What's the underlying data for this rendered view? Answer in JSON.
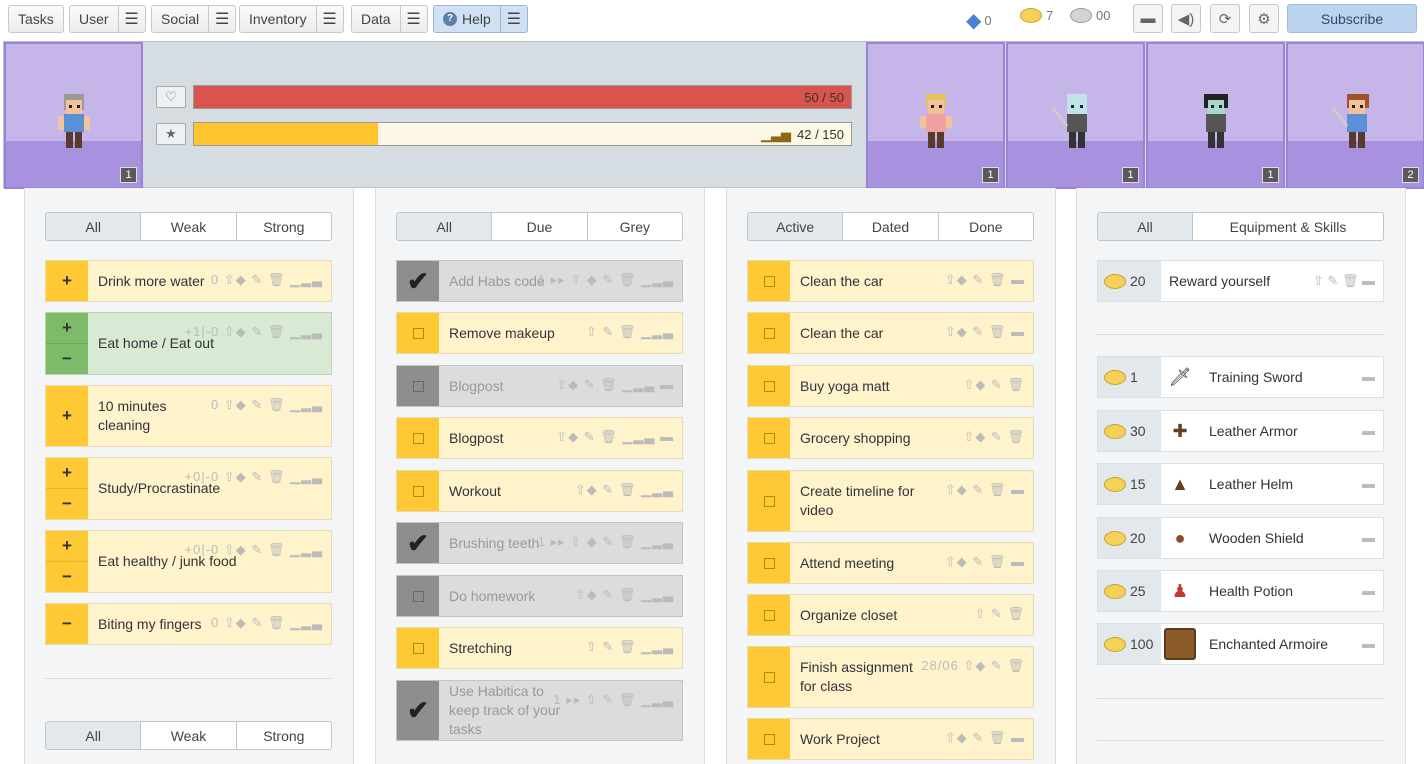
{
  "nav": {
    "menus": [
      "Tasks",
      "User",
      "Social",
      "Inventory",
      "Data",
      "Help"
    ],
    "gems": "0",
    "gold": "7",
    "silver": "00",
    "subscribe": "Subscribe"
  },
  "header": {
    "player_level": "1",
    "hp_text": "50 / 50",
    "hp_fraction": 1.0,
    "xp_text": "42 / 150",
    "xp_fraction": 0.28,
    "party_levels": [
      "1",
      "1",
      "1",
      "2"
    ]
  },
  "habits": {
    "filters": [
      "All",
      "Weak",
      "Strong"
    ],
    "items": [
      {
        "text": "Drink more water",
        "meta": "0 ⇧◆ ✎ 🗑 ▁▂▃"
      },
      {
        "text": "Eat home / Eat out",
        "meta": "+1|-0 ⇧◆ ✎ 🗑 ▁▂▃"
      },
      {
        "text": "10 minutes cleaning",
        "meta": "0 ⇧◆ ✎ 🗑 ▁▂▃"
      },
      {
        "text": "Study/Procrastinate",
        "meta": "+0|-0 ⇧◆ ✎ 🗑 ▁▂▃"
      },
      {
        "text": "Eat healthy / junk food",
        "meta": "+0|-0 ⇧◆ ✎ 🗑 ▁▂▃"
      },
      {
        "text": "Biting my fingers",
        "meta": "0 ⇧◆ ✎ 🗑 ▁▂▃"
      }
    ],
    "filters2": [
      "All",
      "Weak",
      "Strong"
    ]
  },
  "dailies": {
    "filters": [
      "All",
      "Due",
      "Grey"
    ],
    "items": [
      {
        "text": "Add Habs code",
        "meta": "1 ▸▸ ⇧ ◆ ✎ 🗑 ▁▂▃"
      },
      {
        "text": "Remove makeup",
        "meta": "⇧ ✎ 🗑 ▁▂▃"
      },
      {
        "text": "Blogpost",
        "meta": "⇧◆ ✎ 🗑 ▁▂▃ ▬"
      },
      {
        "text": "Blogpost",
        "meta": "⇧◆ ✎ 🗑 ▁▂▃ ▬"
      },
      {
        "text": "Workout",
        "meta": "⇧◆ ✎ 🗑 ▁▂▃"
      },
      {
        "text": "Brushing teeth",
        "meta": "1 ▸▸ ⇧ ◆ ✎ 🗑 ▁▂▃"
      },
      {
        "text": "Do homework",
        "meta": "⇧◆ ✎ 🗑 ▁▂▃"
      },
      {
        "text": "Stretching",
        "meta": "⇧ ✎ 🗑 ▁▂▃"
      },
      {
        "text": "Use Habitica to keep track of your tasks",
        "meta": "1 ▸▸ ⇧ ✎ 🗑 ▁▂▃"
      }
    ]
  },
  "todos": {
    "filters": [
      "Active",
      "Dated",
      "Done"
    ],
    "items": [
      {
        "text": "Clean the car",
        "meta": "⇧◆ ✎ 🗑 ▬"
      },
      {
        "text": "Clean the car",
        "meta": "⇧◆ ✎ 🗑 ▬"
      },
      {
        "text": "Buy yoga matt",
        "meta": "⇧◆ ✎ 🗑"
      },
      {
        "text": "Grocery shopping",
        "meta": "⇧◆ ✎ 🗑"
      },
      {
        "text": "Create timeline for video",
        "meta": "⇧◆ ✎ 🗑 ▬"
      },
      {
        "text": "Attend meeting",
        "meta": "⇧◆ ✎ 🗑 ▬"
      },
      {
        "text": "Organize closet",
        "meta": "⇧ ✎ 🗑"
      },
      {
        "text": "Finish assignment for class",
        "meta": "28/06 ⇧◆ ✎ 🗑"
      },
      {
        "text": "Work Project",
        "meta": "⇧◆ ✎ 🗑 ▬"
      }
    ]
  },
  "rewards": {
    "filters": [
      "All",
      "Equipment & Skills"
    ],
    "custom": [
      {
        "price": "20",
        "text": "Reward yourself",
        "meta": "⇧ ✎ 🗑 ▬"
      }
    ],
    "items": [
      {
        "price": "1",
        "text": "Training Sword",
        "icon": "sword-icon"
      },
      {
        "price": "30",
        "text": "Leather Armor",
        "icon": "armor-icon"
      },
      {
        "price": "15",
        "text": "Leather Helm",
        "icon": "helm-icon"
      },
      {
        "price": "20",
        "text": "Wooden Shield",
        "icon": "shield-icon"
      },
      {
        "price": "25",
        "text": "Health Potion",
        "icon": "potion-icon"
      },
      {
        "price": "100",
        "text": "Enchanted Armoire",
        "icon": "armoire-icon"
      }
    ]
  },
  "colors": {
    "hp": "#d9534f",
    "xp": "#ffc42e",
    "habit": "#ffc936",
    "good": "#7dbb6b",
    "grey": "#8e8e8e"
  }
}
